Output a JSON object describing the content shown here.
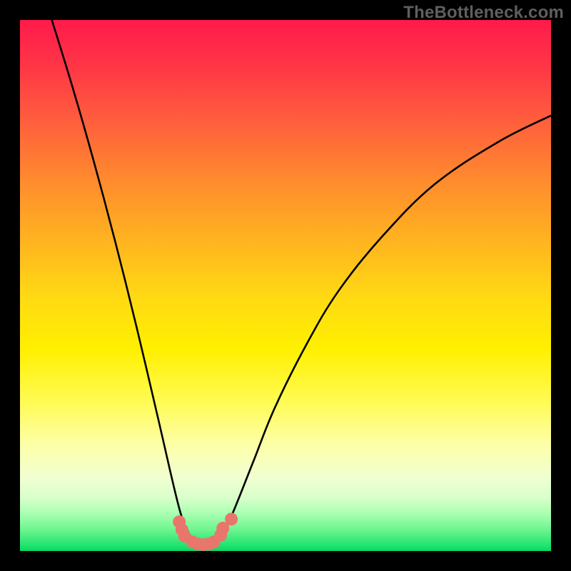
{
  "watermark": "TheBottleneck.com",
  "chart_data": {
    "type": "line",
    "title": "",
    "xlabel": "",
    "ylabel": "",
    "xlim": [
      0,
      1
    ],
    "ylim": [
      0,
      1
    ],
    "series": [
      {
        "name": "bottleneck-curve",
        "x": [
          0.06,
          0.1,
          0.14,
          0.18,
          0.22,
          0.26,
          0.3,
          0.32,
          0.33,
          0.34,
          0.36,
          0.38,
          0.4,
          0.44,
          0.48,
          0.54,
          0.6,
          0.68,
          0.78,
          0.9,
          1.0
        ],
        "values": [
          1.0,
          0.87,
          0.73,
          0.58,
          0.42,
          0.25,
          0.08,
          0.03,
          0.015,
          0.012,
          0.015,
          0.03,
          0.07,
          0.17,
          0.27,
          0.39,
          0.49,
          0.59,
          0.69,
          0.77,
          0.82
        ]
      },
      {
        "name": "markers",
        "x": [
          0.3,
          0.305,
          0.31,
          0.325,
          0.335,
          0.345,
          0.355,
          0.365,
          0.378,
          0.382,
          0.398
        ],
        "values": [
          0.055,
          0.04,
          0.028,
          0.017,
          0.013,
          0.012,
          0.013,
          0.017,
          0.03,
          0.043,
          0.06
        ]
      }
    ],
    "marker_color": "#e8766c",
    "curve_color": "#000000",
    "curve_width": 2.6,
    "marker_radius": 9
  }
}
